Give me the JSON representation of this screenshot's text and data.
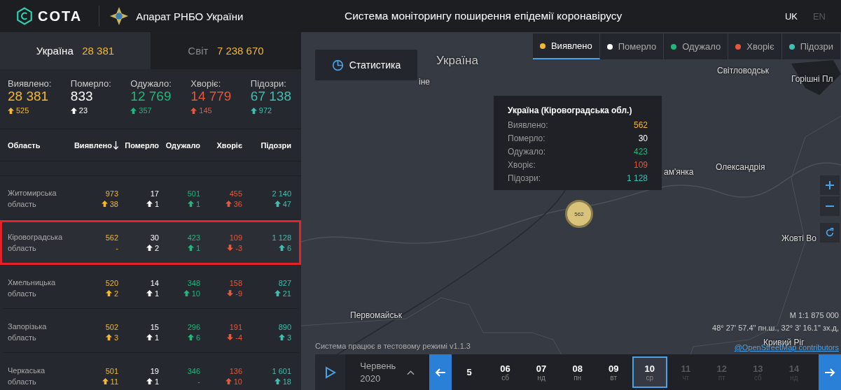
{
  "header": {
    "logo": "COTA",
    "org": "Апарат РНБО України",
    "title": "Система моніторингу поширення епідемії коронавірусу",
    "languages": [
      {
        "label": "UK",
        "selected": true
      },
      {
        "label": "EN",
        "selected": false
      }
    ]
  },
  "scope_tabs": [
    {
      "label": "Україна",
      "value": "28 381",
      "selected": true
    },
    {
      "label": "Світ",
      "value": "7 238 670",
      "selected": false
    }
  ],
  "summary": [
    {
      "label": "Виявлено:",
      "value": "28 381",
      "delta": "525"
    },
    {
      "label": "Померло:",
      "value": "833",
      "delta": "23"
    },
    {
      "label": "Одужало:",
      "value": "12 769",
      "delta": "357"
    },
    {
      "label": "Хворіє:",
      "value": "14 779",
      "delta": "145"
    },
    {
      "label": "Підозри:",
      "value": "67 138",
      "delta": "972"
    }
  ],
  "table": {
    "region_column": "Область",
    "columns": [
      {
        "label": "Виявлено",
        "sorted": true
      },
      {
        "label": "Померло",
        "sorted": false
      },
      {
        "label": "Одужало",
        "sorted": false
      },
      {
        "label": "Хворіє",
        "sorted": false
      },
      {
        "label": "Підозри",
        "sorted": false
      }
    ],
    "rows": [
      {
        "name": "Житомирська область",
        "selected": false,
        "cells": [
          {
            "value": "973",
            "delta": "38",
            "kind": "up"
          },
          {
            "value": "17",
            "delta": "1",
            "kind": "up"
          },
          {
            "value": "501",
            "delta": "1",
            "kind": "up"
          },
          {
            "value": "455",
            "delta": "36",
            "kind": "up"
          },
          {
            "value": "2 140",
            "delta": "47",
            "kind": "up"
          }
        ]
      },
      {
        "name": "Кіровоградська область",
        "selected": true,
        "cells": [
          {
            "value": "562",
            "delta": "-",
            "kind": "none"
          },
          {
            "value": "30",
            "delta": "2",
            "kind": "up"
          },
          {
            "value": "423",
            "delta": "1",
            "kind": "up"
          },
          {
            "value": "109",
            "delta": "-3",
            "kind": "down"
          },
          {
            "value": "1 128",
            "delta": "6",
            "kind": "up"
          }
        ]
      },
      {
        "name": "Хмельницька область",
        "selected": false,
        "cells": [
          {
            "value": "520",
            "delta": "2",
            "kind": "up"
          },
          {
            "value": "14",
            "delta": "1",
            "kind": "up"
          },
          {
            "value": "348",
            "delta": "10",
            "kind": "up"
          },
          {
            "value": "158",
            "delta": "-9",
            "kind": "down"
          },
          {
            "value": "827",
            "delta": "21",
            "kind": "up"
          }
        ]
      },
      {
        "name": "Запорізька область",
        "selected": false,
        "cells": [
          {
            "value": "502",
            "delta": "3",
            "kind": "up"
          },
          {
            "value": "15",
            "delta": "1",
            "kind": "up"
          },
          {
            "value": "296",
            "delta": "6",
            "kind": "up"
          },
          {
            "value": "191",
            "delta": "-4",
            "kind": "down"
          },
          {
            "value": "890",
            "delta": "3",
            "kind": "up"
          }
        ]
      },
      {
        "name": "Черкаська область",
        "selected": false,
        "cells": [
          {
            "value": "501",
            "delta": "11",
            "kind": "up"
          },
          {
            "value": "19",
            "delta": "1",
            "kind": "up"
          },
          {
            "value": "346",
            "delta": "-",
            "kind": "none"
          },
          {
            "value": "136",
            "delta": "10",
            "kind": "up"
          },
          {
            "value": "1 601",
            "delta": "18",
            "kind": "up"
          }
        ]
      }
    ]
  },
  "map": {
    "stats_button": "Статистика",
    "legend": [
      {
        "label": "Виявлено",
        "color": "#f5b731",
        "selected": true
      },
      {
        "label": "Померло",
        "color": "#ffffff",
        "selected": false
      },
      {
        "label": "Одужало",
        "color": "#1fb87a",
        "selected": false
      },
      {
        "label": "Хворіє",
        "color": "#e8573a",
        "selected": false
      },
      {
        "label": "Підозри",
        "color": "#3fbfb0",
        "selected": false
      }
    ],
    "places": [
      {
        "label": "Україна",
        "kind": "country"
      },
      {
        "label": "іне",
        "kind": "city"
      },
      {
        "label": "Світловодськ",
        "kind": "city"
      },
      {
        "label": "Горішні Пл",
        "kind": "city"
      },
      {
        "label": "ам'янка",
        "kind": "city"
      },
      {
        "label": "Олександрія",
        "kind": "city"
      },
      {
        "label": "Жовті Во",
        "kind": "city"
      },
      {
        "label": "Первомайськ",
        "kind": "city"
      },
      {
        "label": "Кривий Ріг",
        "kind": "city"
      }
    ],
    "tooltip": {
      "title": "Україна (Кіровоградська обл.)",
      "rows": [
        {
          "label": "Виявлено:",
          "value": "562"
        },
        {
          "label": "Померло:",
          "value": "30"
        },
        {
          "label": "Одужало:",
          "value": "423"
        },
        {
          "label": "Хворіє:",
          "value": "109"
        },
        {
          "label": "Підозри:",
          "value": "1 128"
        }
      ]
    },
    "marker": "562",
    "scale": "М 1:1 875 000",
    "coords": "48° 27' 57.4\" пн.ш., 32° 3' 16.1\" зх.д,",
    "attribution": "@OpenStreetMap contributors",
    "status": "Система працює в тестовому режимі v1.1.3"
  },
  "timeline": {
    "month": "Червень",
    "year": "2020",
    "days": [
      {
        "day": "5",
        "selected": false,
        "disabled": false
      },
      {
        "day": "06",
        "weekday": "сб",
        "selected": false,
        "disabled": false
      },
      {
        "day": "07",
        "weekday": "нд",
        "selected": false,
        "disabled": false
      },
      {
        "day": "08",
        "weekday": "пн",
        "selected": false,
        "disabled": false
      },
      {
        "day": "09",
        "weekday": "вт",
        "selected": false,
        "disabled": false
      },
      {
        "day": "10",
        "weekday": "ср",
        "selected": true,
        "disabled": false
      },
      {
        "day": "11",
        "weekday": "чт",
        "selected": false,
        "disabled": true
      },
      {
        "day": "12",
        "weekday": "пт",
        "selected": false,
        "disabled": true
      },
      {
        "day": "13",
        "weekday": "сб",
        "selected": false,
        "disabled": true
      },
      {
        "day": "14",
        "weekday": "нд",
        "selected": false,
        "disabled": true
      }
    ]
  }
}
